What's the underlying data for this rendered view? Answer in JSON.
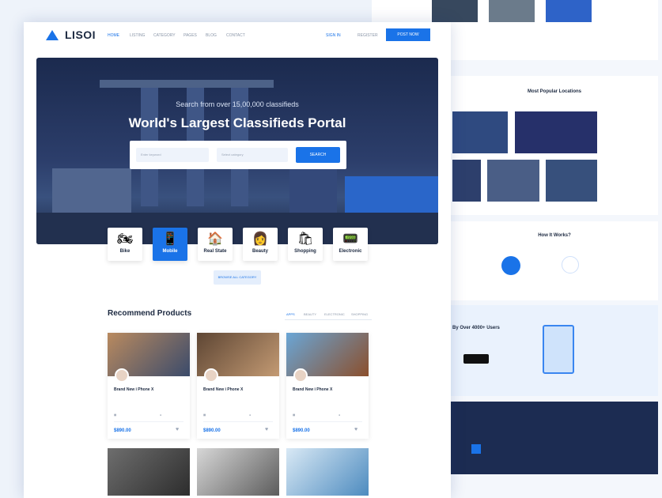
{
  "brand": {
    "name": "LISOI"
  },
  "nav": {
    "links": [
      "HOME",
      "LISTING",
      "CATEGORY",
      "PAGES",
      "BLOG",
      "CONTACT"
    ],
    "sign_in": "SIGN IN",
    "register": "REGISTER",
    "post_button": "POST NOW"
  },
  "hero": {
    "subtitle": "Search from over 15,00,000 classifieds",
    "title": "World's Largest Classifieds Portal",
    "keyword_placeholder": "Enter keyword",
    "category_placeholder": "Select category",
    "search_button": "SEARCH"
  },
  "categories": [
    {
      "label": "Bike",
      "icon": "motorbike-icon",
      "glyph": "🏍"
    },
    {
      "label": "Mobile",
      "icon": "mobile-icon",
      "glyph": "📱"
    },
    {
      "label": "Real State",
      "icon": "house-icon",
      "glyph": "🏠"
    },
    {
      "label": "Beauty",
      "icon": "woman-icon",
      "glyph": "👩"
    },
    {
      "label": "Shopping",
      "icon": "shopping-icon",
      "glyph": "🛍"
    },
    {
      "label": "Electronic",
      "icon": "electronic-icon",
      "glyph": "📟"
    }
  ],
  "browse_button": "BROWSE ALL CATEGORY",
  "recommend": {
    "title": "Recommend Products",
    "tabs": [
      "APPS",
      "BEAUTY",
      "ELECTRONIC",
      "SHOPPING"
    ],
    "cards": [
      {
        "title": "Brand New i Phone X",
        "price": "$890.00"
      },
      {
        "title": "Brand New i Phone X",
        "price": "$890.00"
      },
      {
        "title": "Brand New i Phone X",
        "price": "$890.00"
      }
    ]
  },
  "backpage": {
    "locations_title": "Most Popular Locations",
    "how_title": "How It Works?",
    "users_title": "By Over 4000+ Users"
  },
  "colors": {
    "accent": "#1a73e8",
    "dark": "#1c2940",
    "footer": "#1c2c52"
  }
}
